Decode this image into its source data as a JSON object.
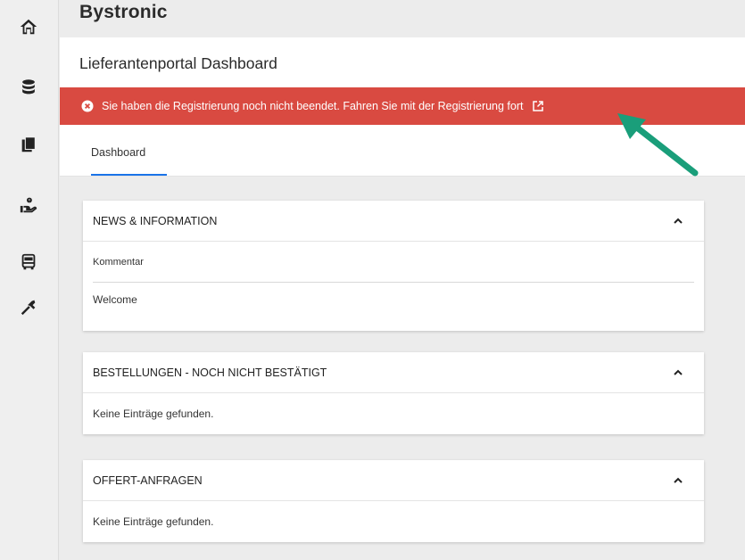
{
  "brand": {
    "name": "Bystronic"
  },
  "header": {
    "title": "Lieferantenportal Dashboard"
  },
  "alert": {
    "message": "Sie haben die Registrierung noch nicht beendet. Fahren Sie mit der Registrierung fort",
    "color": "#d94a41"
  },
  "tabs": [
    {
      "label": "Dashboard",
      "active": true
    }
  ],
  "sidebar": {
    "items": [
      {
        "icon": "home-icon"
      },
      {
        "icon": "database-icon"
      },
      {
        "icon": "documents-icon"
      },
      {
        "icon": "support-hand-icon"
      },
      {
        "icon": "bus-icon"
      },
      {
        "icon": "tools-icon"
      }
    ]
  },
  "cards": {
    "news": {
      "title": "NEWS & INFORMATION",
      "items": [
        "Kommentar",
        "Welcome"
      ]
    },
    "orders": {
      "title": "BESTELLUNGEN - NOCH NICHT BESTÄTIGT",
      "empty": "Keine Einträge gefunden."
    },
    "quotes": {
      "title": "OFFERT-ANFRAGEN",
      "empty": "Keine Einträge gefunden."
    }
  },
  "colors": {
    "accent": "#1a73e8",
    "arrow": "#1a9e7a",
    "alert": "#d94a41"
  }
}
